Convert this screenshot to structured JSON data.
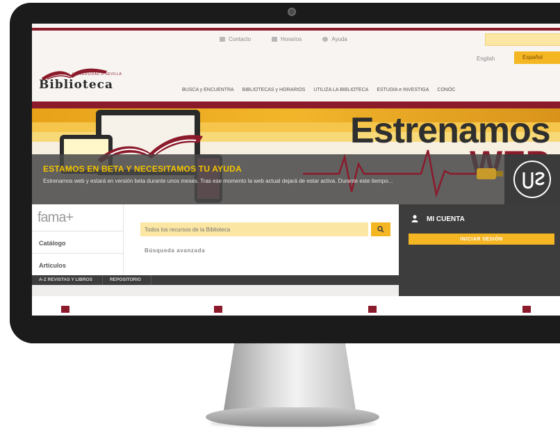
{
  "site": {
    "top_links": [
      {
        "label": "Contacto",
        "icon": "mail-icon"
      },
      {
        "label": "Horarios",
        "icon": "clock-icon"
      },
      {
        "label": "Ayuda",
        "icon": "help-icon"
      }
    ],
    "lang_en": "English",
    "lang_es": "Español",
    "logo_sub": "UNIVERSIDAD D SEVILLA",
    "logo_text": "Biblioteca",
    "nav": [
      "BUSCA y ENCUENTRA",
      "BIBLIOTECAS y HORARIOS",
      "UTILIZA LA BIBLIOTECA",
      "ESTUDIA e INVESTIGA",
      "CONÓC"
    ]
  },
  "banner": {
    "headline": "Estrenamos",
    "headline2": "WEB",
    "overlay_title": "ESTAMOS EN BETA Y NECESITAMOS TU AYUDA",
    "overlay_text": "Estrenamos web y estará en versión beta durante unos meses. Tras ese momento la web actual dejará de estar activa. Durante este tiempo..."
  },
  "search": {
    "brand": "fama+",
    "tabs": [
      "Catálogo",
      "Artículos"
    ],
    "placeholder": "Todos los recursos de la Biblioteca",
    "advanced": "Búsqueda avanzada",
    "subbar": [
      "A-Z REVISTAS Y LIBROS",
      "REPOSITORIO"
    ]
  },
  "account": {
    "title": "MI CUENTA",
    "button": "INICIAR SESIÓN"
  },
  "colors": {
    "maroon": "#8b1a2b",
    "yellow": "#f5b623",
    "dark": "#3d3d3d"
  }
}
